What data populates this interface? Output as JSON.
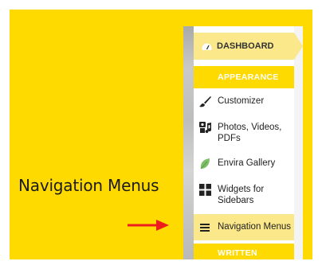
{
  "caption": "Navigation Menus",
  "colors": {
    "background": "#ffda00",
    "highlight": "#fbe88a",
    "arrow": "#ee1c1c"
  },
  "menu": {
    "dashboard": {
      "label": "DASHBOARD",
      "icon": "dashboard-gauge-icon"
    },
    "appearance_section": "APPEARANCE",
    "items": [
      {
        "label": "Customizer",
        "icon": "paintbrush-icon"
      },
      {
        "label": "Photos, Videos, PDFs",
        "icon": "media-icon"
      },
      {
        "label": "Envira Gallery",
        "icon": "leaf-icon"
      },
      {
        "label": "Widgets for Sidebars",
        "icon": "widgets-grid-icon"
      },
      {
        "label": "Navigation Menus",
        "icon": "menu-lines-icon",
        "active": true
      }
    ],
    "written_content_section": "WRITTEN CONTENT"
  }
}
